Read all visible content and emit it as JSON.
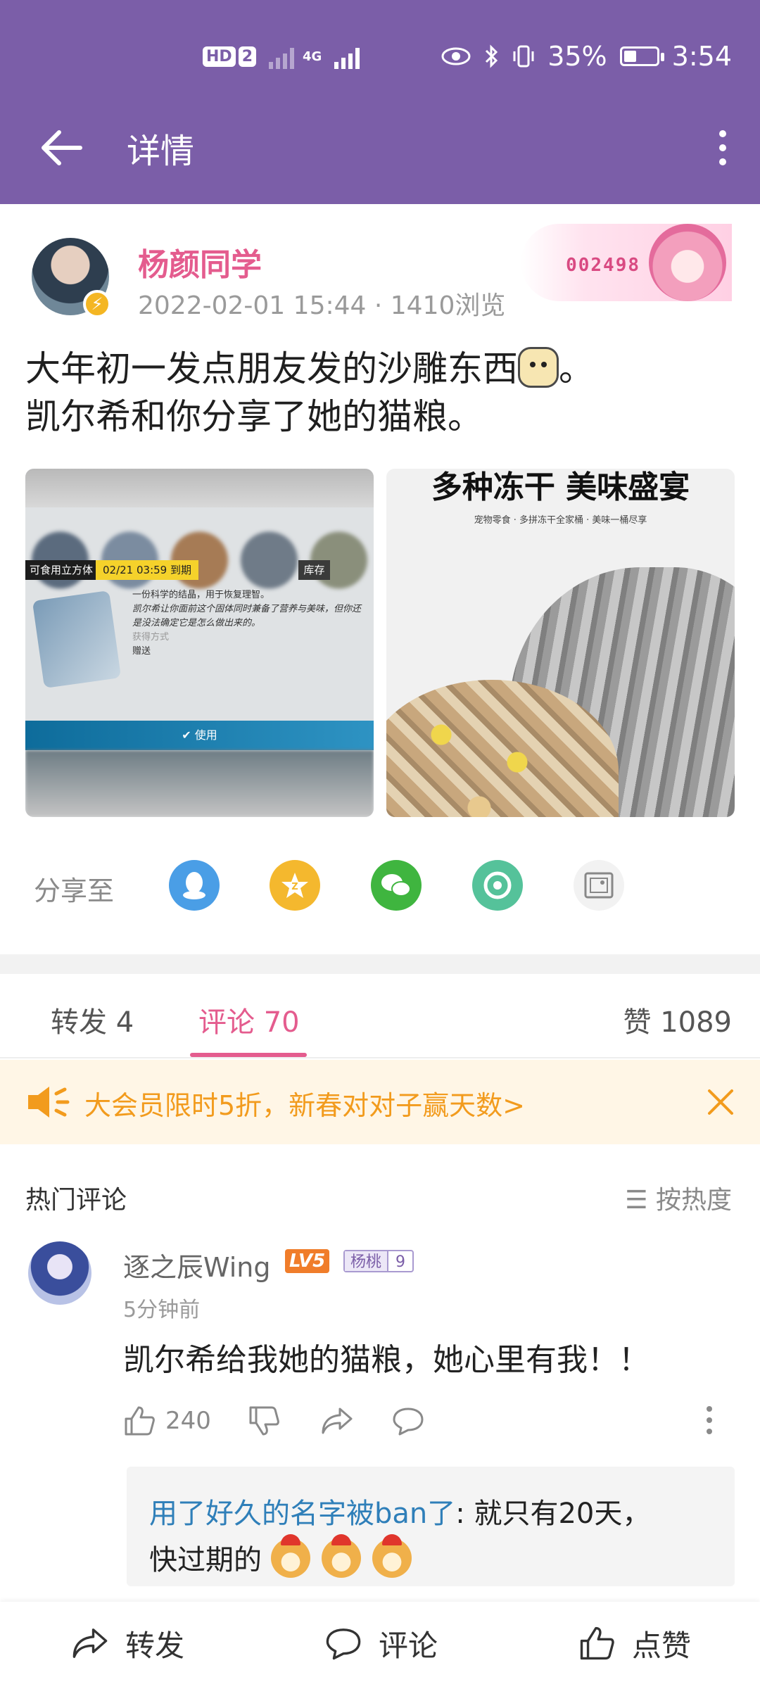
{
  "status_bar": {
    "hd_labels": [
      "HD",
      "2"
    ],
    "signal_label": "4G",
    "battery": "35%",
    "time": "3:54"
  },
  "app_bar": {
    "title": "详情",
    "back_icon": "back-arrow-icon",
    "more_icon": "more-vert-icon"
  },
  "post": {
    "author": "杨颜同学",
    "date": "2022-02-01 15:44",
    "separator": "·",
    "views": "1410浏览",
    "fan_badge_number": "002498",
    "text_line1": "大年初一发点朋友发的沙雕东西",
    "text_line1_end": "。",
    "text_line2": "凯尔希和你分享了她的猫粮。"
  },
  "image1": {
    "item_label": "可食用立方体",
    "date_label": "02/21 03:59",
    "expire_label": "到期",
    "stock_label": "库存",
    "desc_line1": "一份科学的结晶，用于恢复理智。",
    "desc_line2": "凯尔希让你面前这个固体同时兼备了营养与美味，但你还是没法确定它是怎么做出来的。",
    "source_label": "获得方式",
    "gift_label": "赠送",
    "use_label": "使用"
  },
  "image2": {
    "headline": "多种冻干 美味盛宴",
    "subline": "宠物零食 · 多拼冻干全家桶 · 美味一桶尽享"
  },
  "share": {
    "label": "分享至",
    "targets": [
      "qq-icon",
      "qzone-icon",
      "wechat-icon",
      "moments-icon",
      "save-image-icon"
    ]
  },
  "tabs": {
    "repost": "转发 4",
    "comments": "评论 70",
    "likes": "赞 1089"
  },
  "banner": {
    "text": "大会员限时5折，新春对对子赢天数>"
  },
  "comments": {
    "section_title": "热门评论",
    "sort_label": "按热度",
    "items": [
      {
        "name": "逐之辰Wing",
        "level": "LV5",
        "fan_name": "杨桃",
        "fan_level": "9",
        "time": "5分钟前",
        "text": "凯尔希给我她的猫粮，她心里有我！！",
        "like_count": "240",
        "reply_name": "用了好久的名字被ban了",
        "reply_text": ": 就只有20天，",
        "reply_text2": "快过期的"
      }
    ]
  },
  "bottom_bar": {
    "repost": "转发",
    "comment": "评论",
    "like": "点赞"
  },
  "colors": {
    "header_purple": "#7b5ea8",
    "accent_pink": "#e45c8e",
    "banner_orange": "#f29b1d"
  }
}
